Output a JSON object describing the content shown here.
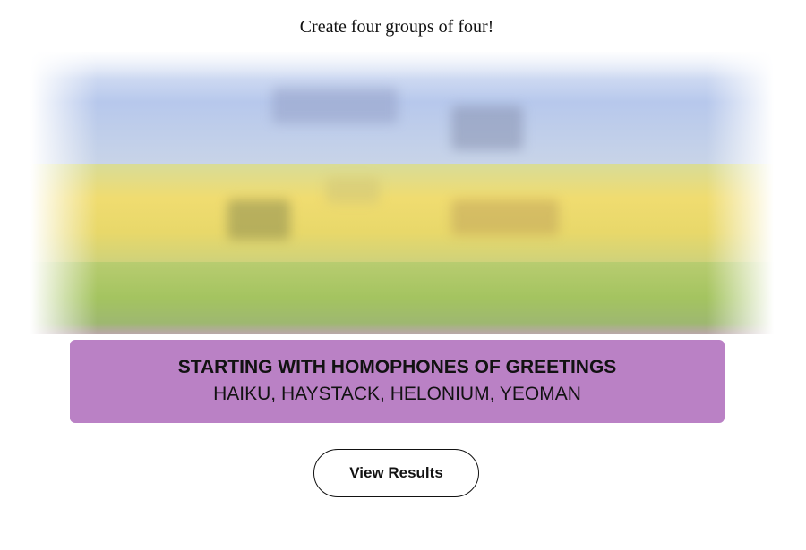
{
  "game": {
    "instructions": "Create four groups of four!"
  },
  "solved_group": {
    "title": "STARTING WITH HOMOPHONES OF GREETINGS",
    "members": "HAIKU, HAYSTACK, HELONIUM, YEOMAN",
    "color": "#ba81c5"
  },
  "board_image": {
    "description_colors": [
      "#b7c8ec",
      "#f0dc70",
      "#a4c460"
    ]
  },
  "actions": {
    "view_results_label": "View Results"
  }
}
